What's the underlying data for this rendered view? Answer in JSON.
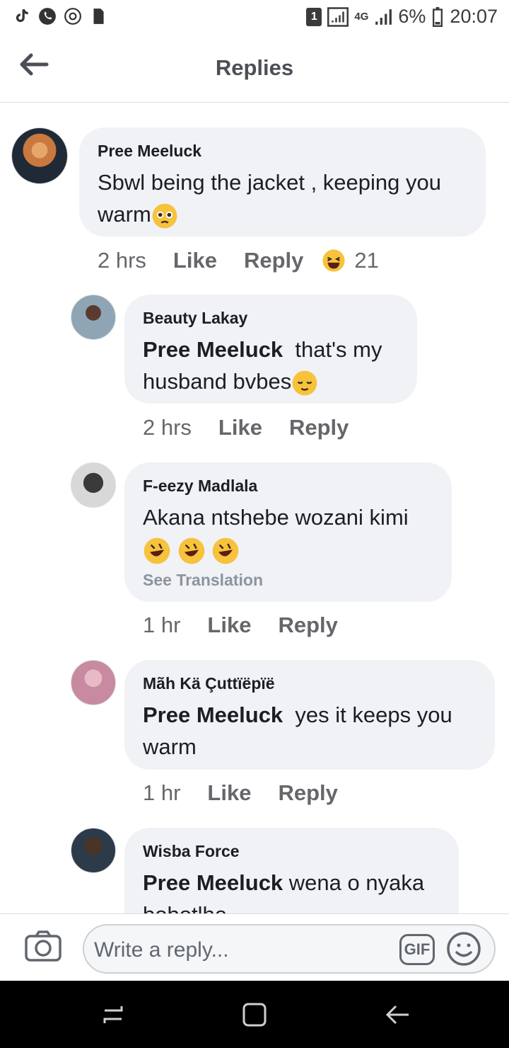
{
  "status_bar": {
    "left_icons": [
      "tiktok-icon",
      "phone-icon",
      "chrome-icon",
      "sd-card-icon"
    ],
    "sim_label": "1",
    "network": "4G",
    "battery": "6%",
    "time": "20:07"
  },
  "header": {
    "title": "Replies",
    "back_icon": "arrow-left-icon"
  },
  "comments": [
    {
      "author": "Pree Meeluck",
      "text": "Sbwl being the jacket , keeping you warm",
      "emoji": "pleading-face",
      "time": "2 hrs",
      "like": "Like",
      "reply": "Reply",
      "reaction": "laughing-face",
      "reaction_count": "21"
    },
    {
      "author": "Beauty Lakay",
      "mention": "Pree Meeluck",
      "text": "that's my husband bvbes",
      "emoji": "relieved-face",
      "time": "2 hrs",
      "like": "Like",
      "reply": "Reply"
    },
    {
      "author": "F-eezy Madlala",
      "text": "Akana ntshebe wozani kimi",
      "emoji": "rolling-laughing x3",
      "translate": "See Translation",
      "time": "1 hr",
      "like": "Like",
      "reply": "Reply"
    },
    {
      "author": "Mãh Kä Çuttïëpïë",
      "mention": "Pree Meeluck",
      "text": "yes it keeps  you warm",
      "time": "1 hr",
      "like": "Like",
      "reply": "Reply"
    },
    {
      "author": "Wisba Force",
      "mention": "Pree Meeluck",
      "text": "wena o nyaka bobotlhe"
    }
  ],
  "composer": {
    "placeholder": "Write a reply...",
    "gif_label": "GIF",
    "camera_icon": "camera-icon",
    "emoji_icon": "smiley-icon"
  },
  "nav_bar": {
    "icons": [
      "recents-icon",
      "home-icon",
      "back-icon"
    ]
  }
}
